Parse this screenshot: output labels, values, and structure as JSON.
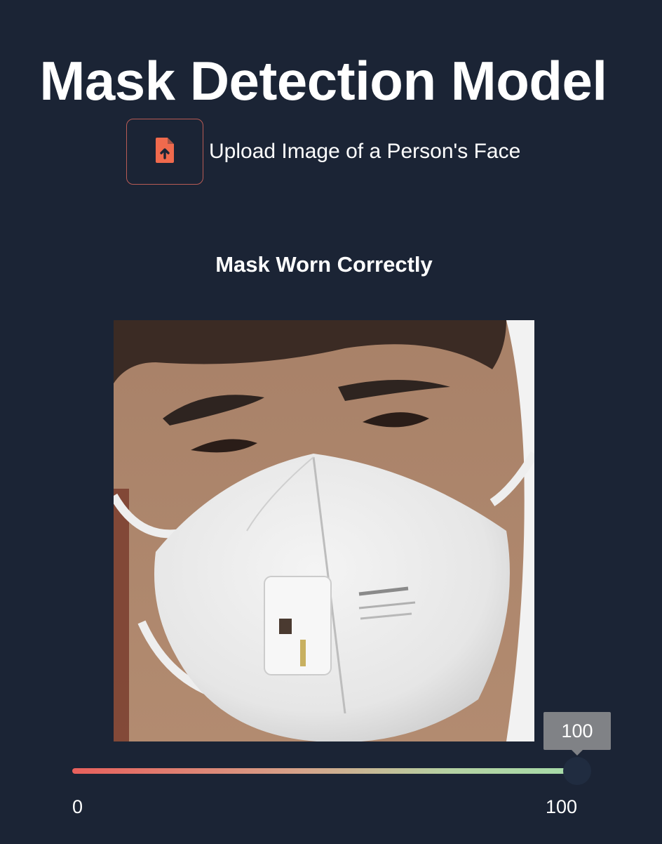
{
  "page": {
    "title": "Mask Detection Model"
  },
  "uploader": {
    "icon": "file-upload-icon",
    "label": "Upload Image of a Person's Face",
    "accent_color": "#f06a4d"
  },
  "result": {
    "label": "Mask Worn Correctly",
    "image_description": "close-up face wearing white respirator mask"
  },
  "confidence_slider": {
    "value": 100,
    "value_text": "100",
    "min": 0,
    "max": 100,
    "min_label": "0",
    "max_label": "100",
    "gradient_start": "#e8605c",
    "gradient_end": "#a6dca9"
  },
  "theme": {
    "background": "#1b2435",
    "text": "#ffffff"
  }
}
